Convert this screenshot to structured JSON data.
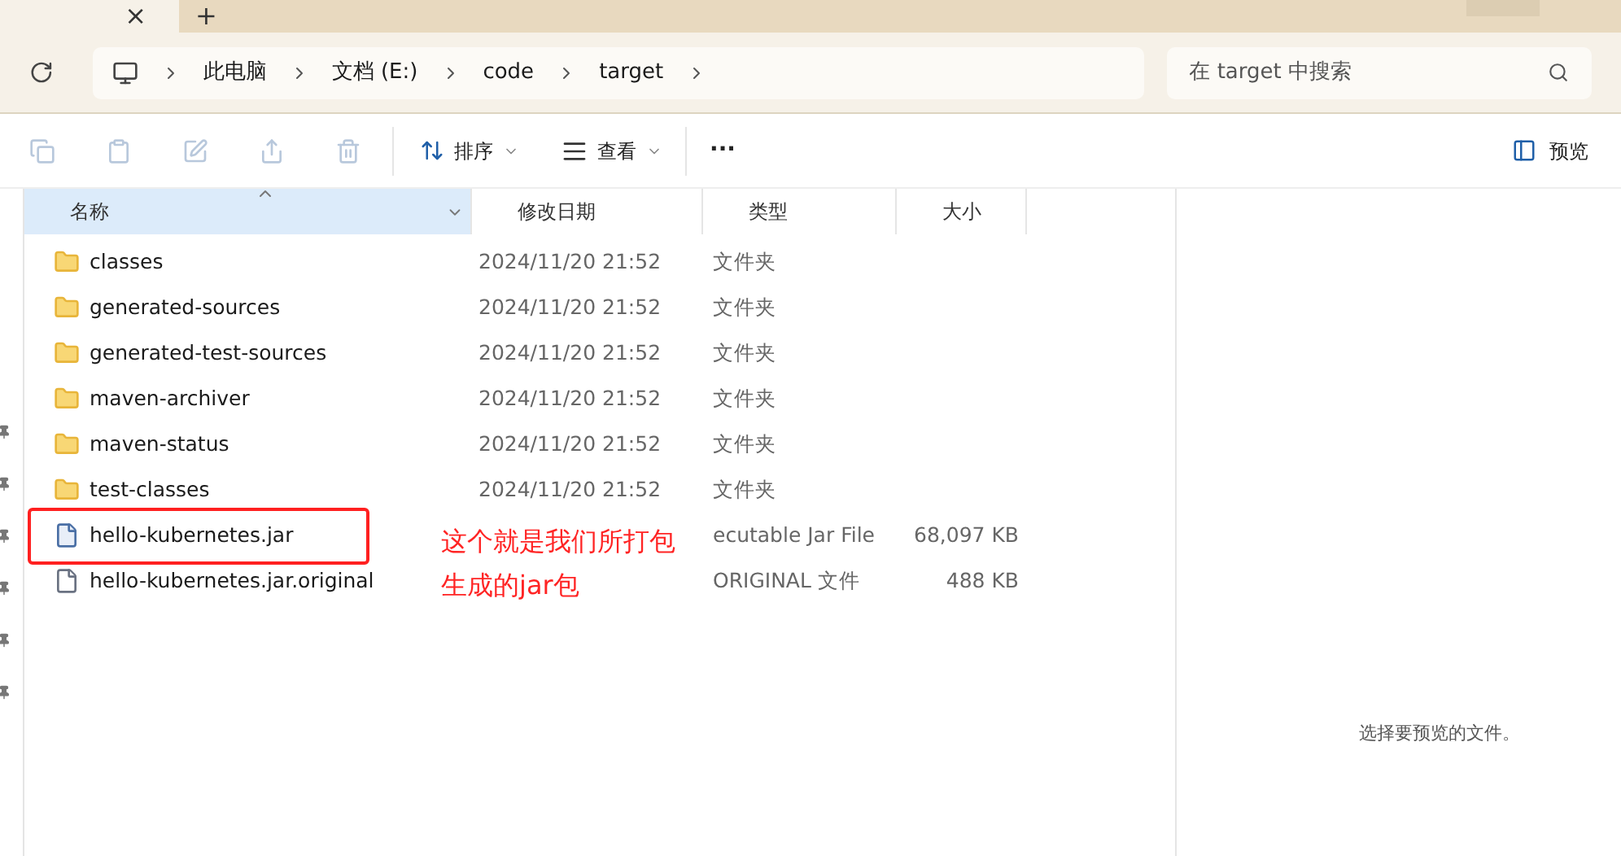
{
  "title_bar": {
    "tab_close": "×",
    "new_tab": "+"
  },
  "address_bar": {
    "breadcrumbs": [
      "此电脑",
      "文档 (E:)",
      "code",
      "target"
    ],
    "search": {
      "placeholder": "在 target 中搜索"
    }
  },
  "toolbar": {
    "sort": "排序",
    "view": "查看",
    "more": "···",
    "preview": "预览"
  },
  "table": {
    "columns": [
      {
        "label": "名称",
        "selected": true
      },
      {
        "label": "修改日期",
        "selected": false
      },
      {
        "label": "类型",
        "selected": false
      },
      {
        "label": "大小",
        "selected": false
      }
    ],
    "rows": [
      {
        "kind": "folder",
        "name": "classes",
        "date": "2024/11/20 21:52",
        "type": "文件夹",
        "size": ""
      },
      {
        "kind": "folder",
        "name": "generated-sources",
        "date": "2024/11/20 21:52",
        "type": "文件夹",
        "size": ""
      },
      {
        "kind": "folder",
        "name": "generated-test-sources",
        "date": "2024/11/20 21:52",
        "type": "文件夹",
        "size": ""
      },
      {
        "kind": "folder",
        "name": "maven-archiver",
        "date": "2024/11/20 21:52",
        "type": "文件夹",
        "size": ""
      },
      {
        "kind": "folder",
        "name": "maven-status",
        "date": "2024/11/20 21:52",
        "type": "文件夹",
        "size": ""
      },
      {
        "kind": "folder",
        "name": "test-classes",
        "date": "2024/11/20 21:52",
        "type": "文件夹",
        "size": ""
      },
      {
        "kind": "jar",
        "name": "hello-kubernetes.jar",
        "date": "",
        "type": "ecutable Jar File",
        "size": "68,097 KB"
      },
      {
        "kind": "file",
        "name": "hello-kubernetes.jar.original",
        "date": "",
        "type": "ORIGINAL 文件",
        "size": "488 KB"
      }
    ]
  },
  "annotation": {
    "lines": [
      "这个就是我们所打包",
      "生成的jar包"
    ]
  },
  "preview_pane": {
    "message": "选择要预览的文件。"
  }
}
